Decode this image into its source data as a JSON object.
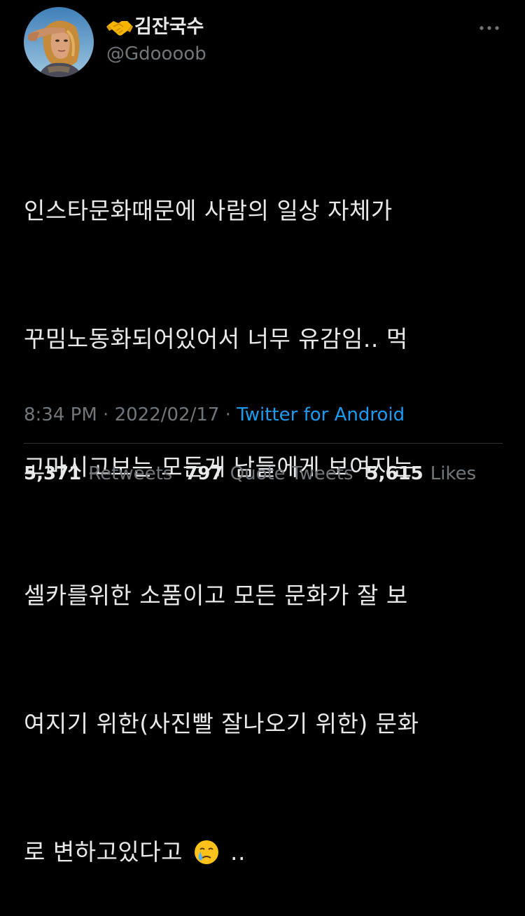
{
  "author": {
    "display_name": "김잔국수",
    "handle": "@Gdoooob",
    "name_prefix_icon": "handshake-icon",
    "avatar_icon": "profile-avatar"
  },
  "tweet": {
    "lines": [
      "인스타문화때문에 사람의 일상 자체가",
      "꾸밈노동화되어있어서 너무 유감임.. 먹",
      "고마시고보는 모든게 남들에게 보여지는",
      "셀카를위한 소품이고 모든 문화가 잘 보",
      "여지기 위한(사진빨 잘나오기 위한) 문화"
    ],
    "last_line_before_emoji": "로 변하고있다고 ",
    "emoji": "crying-face-icon",
    "last_line_after_emoji": " .."
  },
  "meta": {
    "time": "8:34 PM",
    "separator": " · ",
    "date": "2022/02/17",
    "source": "Twitter for Android"
  },
  "stats": {
    "retweets_count": "5,371",
    "retweets_label": "Retweets",
    "quotes_count": "797",
    "quotes_label": "Quote Tweets",
    "likes_count": "5,615",
    "likes_label": "Likes"
  },
  "colors": {
    "background": "#000000",
    "text": "#e7e9ea",
    "secondary": "#71767b",
    "link": "#1d9bf0",
    "divider": "#2f3336"
  }
}
